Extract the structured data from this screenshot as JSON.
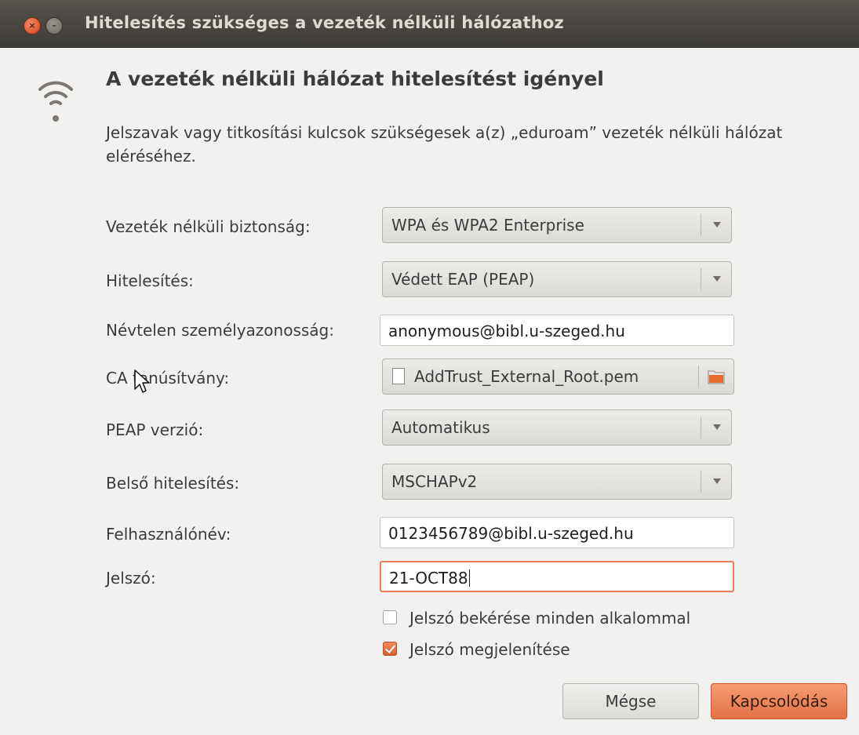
{
  "window": {
    "title": "Hitelesítés szükséges a vezeték nélküli hálózathoz",
    "close_glyph": "×",
    "minimize_glyph": "–"
  },
  "dialog": {
    "heading": "A vezeték nélküli hálózat hitelesítést igényel",
    "description": "Jelszavak vagy titkosítási kulcsok szükségesek a(z) „eduroam” vezeték nélküli hálózat eléréséhez."
  },
  "form": {
    "security": {
      "label": "Vezeték nélküli biztonság:",
      "value": "WPA és WPA2 Enterprise"
    },
    "authentication": {
      "label": "Hitelesítés:",
      "value": "Védett EAP (PEAP)"
    },
    "anonymous_identity": {
      "label": "Névtelen személyazonosság:",
      "value": "anonymous@bibl.u-szeged.hu"
    },
    "ca_certificate": {
      "label": "CA tanúsítvány:",
      "value": "AddTrust_External_Root.pem"
    },
    "peap_version": {
      "label": "PEAP verzió:",
      "value": "Automatikus"
    },
    "inner_auth": {
      "label": "Belső hitelesítés:",
      "value": "MSCHAPv2"
    },
    "username": {
      "label": "Felhasználónév:",
      "value": "0123456789@bibl.u-szeged.hu"
    },
    "password": {
      "label": "Jelszó:",
      "value": "21-OCT88"
    },
    "ask_password_every_time": {
      "label": "Jelszó bekérése minden alkalommal",
      "checked": false
    },
    "show_password": {
      "label": "Jelszó megjelenítése",
      "checked": true
    }
  },
  "buttons": {
    "cancel": "Mégse",
    "connect": "Kapcsolódás"
  },
  "colors": {
    "accent": "#e27344",
    "titlebar": "#3d3b37",
    "background": "#f2f1f0"
  },
  "icons": {
    "network": "wifi-icon",
    "file": "file-icon",
    "folder": "folder-icon",
    "combo_arrow": "chevron-down-icon",
    "pointer": "mouse-pointer-icon"
  }
}
